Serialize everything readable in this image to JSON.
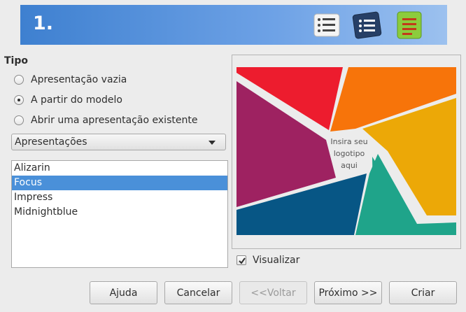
{
  "header": {
    "step_number": "1.",
    "icons": [
      "plain-list-icon",
      "blue-list-icon",
      "green-list-icon"
    ]
  },
  "type_section": {
    "label": "Tipo",
    "options": [
      {
        "label": "Apresentação vazia",
        "checked": false
      },
      {
        "label": "A partir do modelo",
        "checked": true
      },
      {
        "label": "Abrir uma apresentação existente",
        "checked": false
      }
    ]
  },
  "category_select": {
    "selected": "Apresentações"
  },
  "template_list": {
    "items": [
      "Alizarin",
      "Focus",
      "Impress",
      "Midnightblue"
    ],
    "selected_index": 1
  },
  "preview": {
    "logo_placeholder": "Insira seu logotipo aqui",
    "logo_lines": [
      "Insira seu",
      "logotipo",
      "aqui"
    ],
    "colors": [
      "#ed1c2e",
      "#f7740a",
      "#9e2261",
      "#eca807",
      "#1fa48a",
      "#075685"
    ]
  },
  "visualizar": {
    "label": "Visualizar",
    "checked": true
  },
  "buttons": {
    "help": "Ajuda",
    "cancel": "Cancelar",
    "back": "<<Voltar",
    "next": "Próximo >>",
    "create": "Criar"
  }
}
